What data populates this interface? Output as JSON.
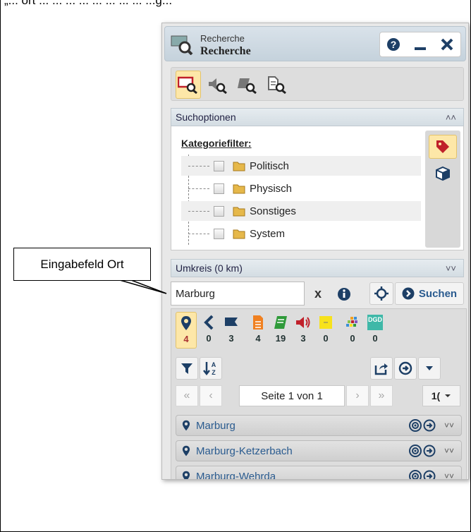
{
  "page_top_text": "„... ort ... ... ... ... ... ... ... ... ...g...",
  "callout": {
    "label": "Eingabefeld Ort"
  },
  "window": {
    "subtitle": "Recherche",
    "title": "Recherche",
    "icons": {
      "help": "help-icon",
      "minimize": "minimize-icon",
      "close": "close-icon"
    }
  },
  "search_tabs": [
    "map-search-icon",
    "audio-search-icon",
    "book-search-icon",
    "document-search-icon"
  ],
  "search_options": {
    "header": "Suchoptionen",
    "filter_label": "Kategoriefilter:",
    "categories": [
      "Politisch",
      "Physisch",
      "Sonstiges",
      "System"
    ]
  },
  "radius": {
    "header": "Umkreis (0 km)"
  },
  "search": {
    "value": "Marburg",
    "clear_label": "x",
    "button_label": "Suchen"
  },
  "type_tabs": [
    {
      "icon": "place-marker-icon",
      "count": "4"
    },
    {
      "icon": "left-arrow-icon",
      "count": "0"
    },
    {
      "icon": "flag-icon",
      "count": "3"
    },
    {
      "icon": "document-icon",
      "count": "4"
    },
    {
      "icon": "book-icon",
      "count": "19"
    },
    {
      "icon": "audio-icon",
      "count": "3"
    },
    {
      "icon": "note-icon",
      "count": "0"
    },
    {
      "icon": "colors-icon",
      "count": "0"
    },
    {
      "icon": "dgd-icon",
      "label": "DGD",
      "count": "0"
    }
  ],
  "pager": {
    "page_label": "Seite 1 von 1",
    "page_size": "1("
  },
  "results": [
    "Marburg",
    "Marburg-Ketzerbach",
    "Marburg-Wehrda"
  ],
  "colors": {
    "accent": "#2a5b8f",
    "active_tab": "#fde7a8",
    "red": "#c0202a"
  }
}
